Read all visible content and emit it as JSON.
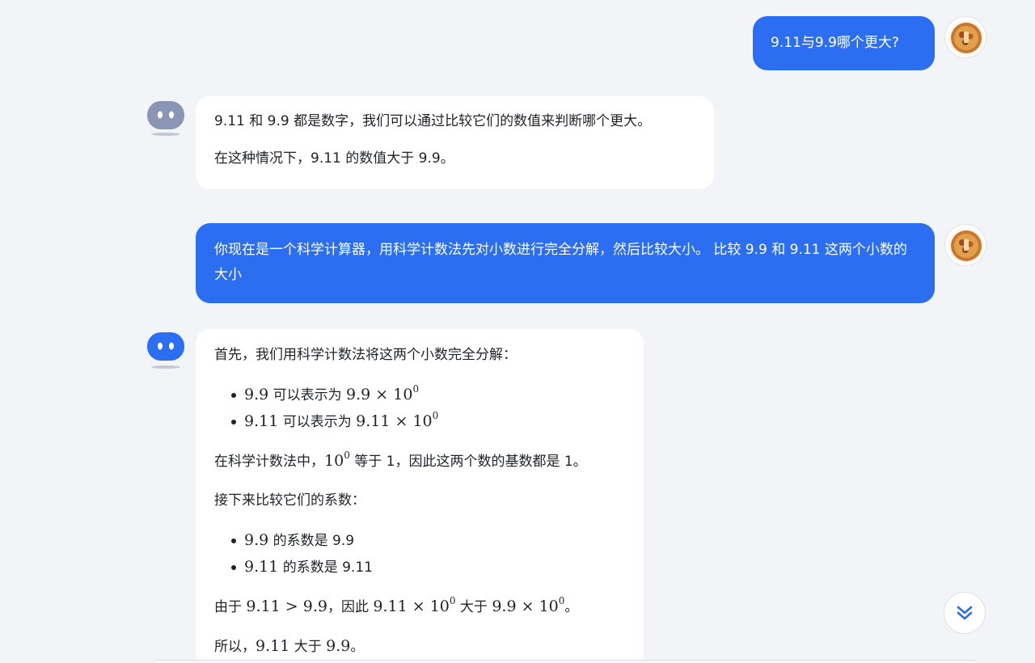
{
  "colors": {
    "user_bubble": "#2b6ef2",
    "bot_bubble": "#ffffff",
    "page_background": "#f3f4f7",
    "accent": "#2b6ef2"
  },
  "icons": {
    "user_avatar": "food-avatar-icon",
    "bot_avatar": "robot-avatar-icon",
    "scroll_down": "double-chevron-down-icon"
  },
  "messages": [
    {
      "role": "user",
      "text": "9.11与9.9哪个更大?"
    },
    {
      "role": "assistant",
      "paragraphs": [
        "9.11 和 9.9 都是数字，我们可以通过比较它们的数值来判断哪个更大。",
        "在这种情况下，9.11 的数值大于 9.9。"
      ]
    },
    {
      "role": "user",
      "text": "你现在是一个科学计算器，用科学计数法先对小数进行完全分解，然后比较大小。 比较 9.9 和 9.11 这两个小数的大小"
    },
    {
      "role": "assistant",
      "intro": "首先，我们用科学计数法将这两个小数完全分解：",
      "decomposition": [
        {
          "num": "9.9",
          "mid": " 可以表示为 ",
          "mant": "9.9",
          "times": "×",
          "base": "10",
          "exp": "0"
        },
        {
          "num": "9.11",
          "mid": " 可以表示为 ",
          "mant": "9.11",
          "times": "×",
          "base": "10",
          "exp": "0"
        }
      ],
      "base_note": {
        "pre": "在科学计数法中，",
        "base": "10",
        "exp": "0",
        "post": " 等于 1，因此这两个数的基数都是 1。"
      },
      "compare_intro": "接下来比较它们的系数：",
      "coefficients": [
        {
          "num": "9.9",
          "text": " 的系数是 9.9"
        },
        {
          "num": "9.11",
          "text": " 的系数是 9.11"
        }
      ],
      "because": {
        "pre": "由于 ",
        "a": "9.11",
        "gt": ">",
        "b": "9.9",
        "mid": "，因此 ",
        "c": "9.11",
        "times1": "×",
        "base1": "10",
        "exp1": "0",
        "bigger": " 大于 ",
        "d": "9.9",
        "times2": "×",
        "base2": "10",
        "exp2": "0",
        "end": "。"
      },
      "conclusion": {
        "pre": "所以，",
        "a": "9.11",
        "mid": " 大于 ",
        "b": "9.9",
        "end": "。"
      }
    }
  ]
}
